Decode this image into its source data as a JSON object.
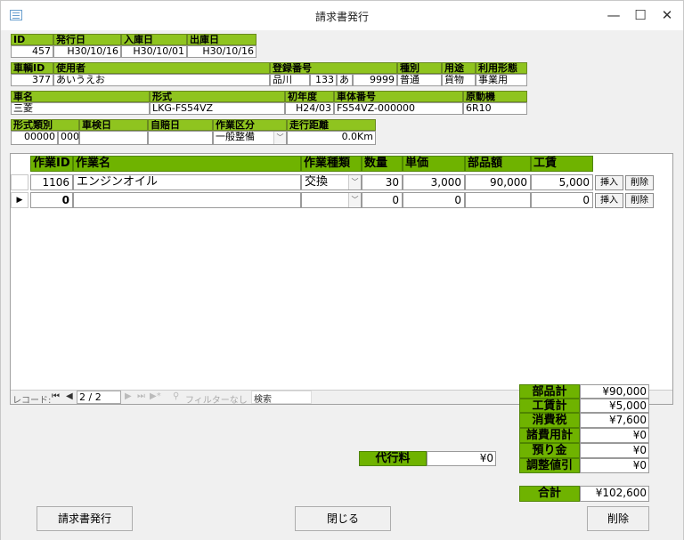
{
  "window": {
    "title": "請求書発行",
    "minimize": "—",
    "maximize": "☐",
    "close": "✕"
  },
  "header": {
    "id_label": "ID",
    "id": "457",
    "issue_label": "発行日",
    "issue": "H30/10/16",
    "in_label": "入庫日",
    "in": "H30/10/01",
    "out_label": "出庫日",
    "out": "H30/10/16",
    "car_id_label": "車輌ID",
    "car_id": "377",
    "user_label": "使用者",
    "user": "あいうえお",
    "reg_label": "登録番号",
    "reg_area": "品川",
    "reg_class": "133",
    "reg_kana": "あ",
    "reg_num": "9999",
    "kind_label": "種別",
    "kind": "普通",
    "use_label": "用途",
    "use": "貨物",
    "form_label": "利用形態",
    "form": "事業用",
    "car_name_label": "車名",
    "car_name": "三菱",
    "model_label": "形式",
    "model": "LKG-FS54VZ",
    "first_year_label": "初年度",
    "first_year": "H24/03",
    "chassis_label": "車体番号",
    "chassis": "FS54VZ-000000",
    "engine_label": "原動機",
    "engine": "6R10",
    "model_cat_label": "形式類別",
    "model_cat_a": "00000",
    "model_cat_b": "000",
    "inspect_label": "車検日",
    "inspect": "",
    "insurance_label": "自賠日",
    "insurance": "",
    "work_div_label": "作業区分",
    "work_div": "一般整備",
    "mileage_label": "走行距離",
    "mileage": "0.0Km"
  },
  "grid": {
    "columns": [
      "作業ID",
      "作業名",
      "作業種類",
      "数量",
      "単価",
      "部品額",
      "工賃"
    ],
    "rows": [
      {
        "id": "1106",
        "name": "エンジンオイル",
        "type": "交換",
        "qty": "30",
        "price": "3,000",
        "parts": "90,000",
        "labor": "5,000",
        "insert": "挿入",
        "delete": "削除"
      },
      {
        "id": "0",
        "name": "",
        "type": "",
        "qty": "0",
        "price": "0",
        "parts": "",
        "labor": "0",
        "insert": "挿入",
        "delete": "削除"
      }
    ],
    "nav": {
      "record_label": "レコード:",
      "position": "2 / 2",
      "filter": "フィルターなし",
      "search": "検索"
    }
  },
  "agency": {
    "label": "代行料",
    "value": "¥0"
  },
  "totals": [
    {
      "label": "部品計",
      "value": "¥90,000"
    },
    {
      "label": "工賃計",
      "value": "¥5,000"
    },
    {
      "label": "消費税",
      "value": "¥7,600"
    },
    {
      "label": "諸費用計",
      "value": "¥0"
    },
    {
      "label": "預り金",
      "value": "¥0"
    },
    {
      "label": "調整値引",
      "value": "¥0"
    }
  ],
  "grand_total": {
    "label": "合計",
    "value": "¥102,600"
  },
  "buttons": {
    "issue": "請求書発行",
    "close": "閉じる",
    "delete": "削除"
  }
}
